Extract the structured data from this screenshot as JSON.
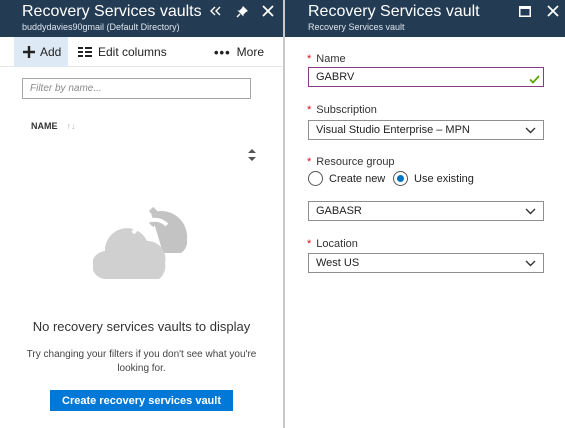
{
  "left_blade": {
    "title": "Recovery Services vaults",
    "subtitle": "buddydavies90gmail (Default Directory)",
    "header_icons": [
      "chevron-double-left-icon",
      "pin-icon",
      "close-icon"
    ],
    "toolbar": {
      "add_label": "Add",
      "edit_columns_label": "Edit columns",
      "more_label": "More"
    },
    "filter": {
      "placeholder": "Filter by name...",
      "value": ""
    },
    "columns": [
      {
        "label": "NAME",
        "sort_glyph": "↑↓"
      }
    ],
    "empty_state": {
      "title": "No recovery services vaults to display",
      "hint": "Try changing your filters if you don't see what you're looking for.",
      "create_button": "Create recovery services vault"
    }
  },
  "right_blade": {
    "title": "Recovery Services vault",
    "subtitle": "Recovery Services vault",
    "header_icons": [
      "maximize-icon",
      "close-icon"
    ],
    "required_marker": "*",
    "name": {
      "label": "Name",
      "value": "GABRV",
      "valid": true
    },
    "subscription": {
      "label": "Subscription",
      "value": "Visual Studio Enterprise – MPN"
    },
    "resource_group": {
      "label": "Resource group",
      "options": [
        {
          "label": "Create new",
          "checked": false
        },
        {
          "label": "Use existing",
          "checked": true
        }
      ],
      "selected_value": "GABASR"
    },
    "location": {
      "label": "Location",
      "value": "West US"
    }
  },
  "colors": {
    "header_bg": "#233b53",
    "primary_button": "#0078d7",
    "required": "#e00b1c",
    "valid_check": "#57a300",
    "name_border": "#8a3a84",
    "radio_selected": "#0072c6"
  }
}
